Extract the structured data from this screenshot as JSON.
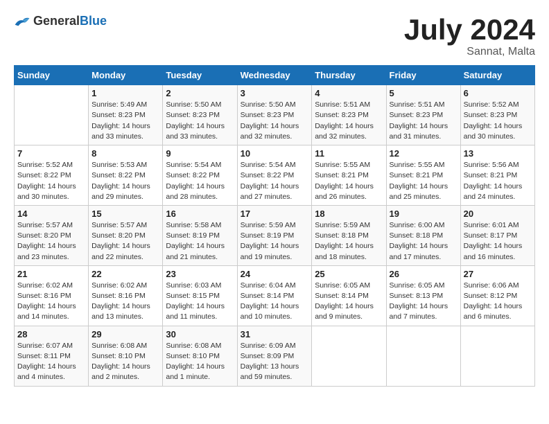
{
  "header": {
    "logo_general": "General",
    "logo_blue": "Blue",
    "title": "July 2024",
    "subtitle": "Sannat, Malta"
  },
  "days_of_week": [
    "Sunday",
    "Monday",
    "Tuesday",
    "Wednesday",
    "Thursday",
    "Friday",
    "Saturday"
  ],
  "weeks": [
    [
      {
        "day": "",
        "info": ""
      },
      {
        "day": "1",
        "info": "Sunrise: 5:49 AM\nSunset: 8:23 PM\nDaylight: 14 hours\nand 33 minutes."
      },
      {
        "day": "2",
        "info": "Sunrise: 5:50 AM\nSunset: 8:23 PM\nDaylight: 14 hours\nand 33 minutes."
      },
      {
        "day": "3",
        "info": "Sunrise: 5:50 AM\nSunset: 8:23 PM\nDaylight: 14 hours\nand 32 minutes."
      },
      {
        "day": "4",
        "info": "Sunrise: 5:51 AM\nSunset: 8:23 PM\nDaylight: 14 hours\nand 32 minutes."
      },
      {
        "day": "5",
        "info": "Sunrise: 5:51 AM\nSunset: 8:23 PM\nDaylight: 14 hours\nand 31 minutes."
      },
      {
        "day": "6",
        "info": "Sunrise: 5:52 AM\nSunset: 8:23 PM\nDaylight: 14 hours\nand 30 minutes."
      }
    ],
    [
      {
        "day": "7",
        "info": "Sunrise: 5:52 AM\nSunset: 8:22 PM\nDaylight: 14 hours\nand 30 minutes."
      },
      {
        "day": "8",
        "info": "Sunrise: 5:53 AM\nSunset: 8:22 PM\nDaylight: 14 hours\nand 29 minutes."
      },
      {
        "day": "9",
        "info": "Sunrise: 5:54 AM\nSunset: 8:22 PM\nDaylight: 14 hours\nand 28 minutes."
      },
      {
        "day": "10",
        "info": "Sunrise: 5:54 AM\nSunset: 8:22 PM\nDaylight: 14 hours\nand 27 minutes."
      },
      {
        "day": "11",
        "info": "Sunrise: 5:55 AM\nSunset: 8:21 PM\nDaylight: 14 hours\nand 26 minutes."
      },
      {
        "day": "12",
        "info": "Sunrise: 5:55 AM\nSunset: 8:21 PM\nDaylight: 14 hours\nand 25 minutes."
      },
      {
        "day": "13",
        "info": "Sunrise: 5:56 AM\nSunset: 8:21 PM\nDaylight: 14 hours\nand 24 minutes."
      }
    ],
    [
      {
        "day": "14",
        "info": "Sunrise: 5:57 AM\nSunset: 8:20 PM\nDaylight: 14 hours\nand 23 minutes."
      },
      {
        "day": "15",
        "info": "Sunrise: 5:57 AM\nSunset: 8:20 PM\nDaylight: 14 hours\nand 22 minutes."
      },
      {
        "day": "16",
        "info": "Sunrise: 5:58 AM\nSunset: 8:19 PM\nDaylight: 14 hours\nand 21 minutes."
      },
      {
        "day": "17",
        "info": "Sunrise: 5:59 AM\nSunset: 8:19 PM\nDaylight: 14 hours\nand 19 minutes."
      },
      {
        "day": "18",
        "info": "Sunrise: 5:59 AM\nSunset: 8:18 PM\nDaylight: 14 hours\nand 18 minutes."
      },
      {
        "day": "19",
        "info": "Sunrise: 6:00 AM\nSunset: 8:18 PM\nDaylight: 14 hours\nand 17 minutes."
      },
      {
        "day": "20",
        "info": "Sunrise: 6:01 AM\nSunset: 8:17 PM\nDaylight: 14 hours\nand 16 minutes."
      }
    ],
    [
      {
        "day": "21",
        "info": "Sunrise: 6:02 AM\nSunset: 8:16 PM\nDaylight: 14 hours\nand 14 minutes."
      },
      {
        "day": "22",
        "info": "Sunrise: 6:02 AM\nSunset: 8:16 PM\nDaylight: 14 hours\nand 13 minutes."
      },
      {
        "day": "23",
        "info": "Sunrise: 6:03 AM\nSunset: 8:15 PM\nDaylight: 14 hours\nand 11 minutes."
      },
      {
        "day": "24",
        "info": "Sunrise: 6:04 AM\nSunset: 8:14 PM\nDaylight: 14 hours\nand 10 minutes."
      },
      {
        "day": "25",
        "info": "Sunrise: 6:05 AM\nSunset: 8:14 PM\nDaylight: 14 hours\nand 9 minutes."
      },
      {
        "day": "26",
        "info": "Sunrise: 6:05 AM\nSunset: 8:13 PM\nDaylight: 14 hours\nand 7 minutes."
      },
      {
        "day": "27",
        "info": "Sunrise: 6:06 AM\nSunset: 8:12 PM\nDaylight: 14 hours\nand 6 minutes."
      }
    ],
    [
      {
        "day": "28",
        "info": "Sunrise: 6:07 AM\nSunset: 8:11 PM\nDaylight: 14 hours\nand 4 minutes."
      },
      {
        "day": "29",
        "info": "Sunrise: 6:08 AM\nSunset: 8:10 PM\nDaylight: 14 hours\nand 2 minutes."
      },
      {
        "day": "30",
        "info": "Sunrise: 6:08 AM\nSunset: 8:10 PM\nDaylight: 14 hours\nand 1 minute."
      },
      {
        "day": "31",
        "info": "Sunrise: 6:09 AM\nSunset: 8:09 PM\nDaylight: 13 hours\nand 59 minutes."
      },
      {
        "day": "",
        "info": ""
      },
      {
        "day": "",
        "info": ""
      },
      {
        "day": "",
        "info": ""
      }
    ]
  ]
}
